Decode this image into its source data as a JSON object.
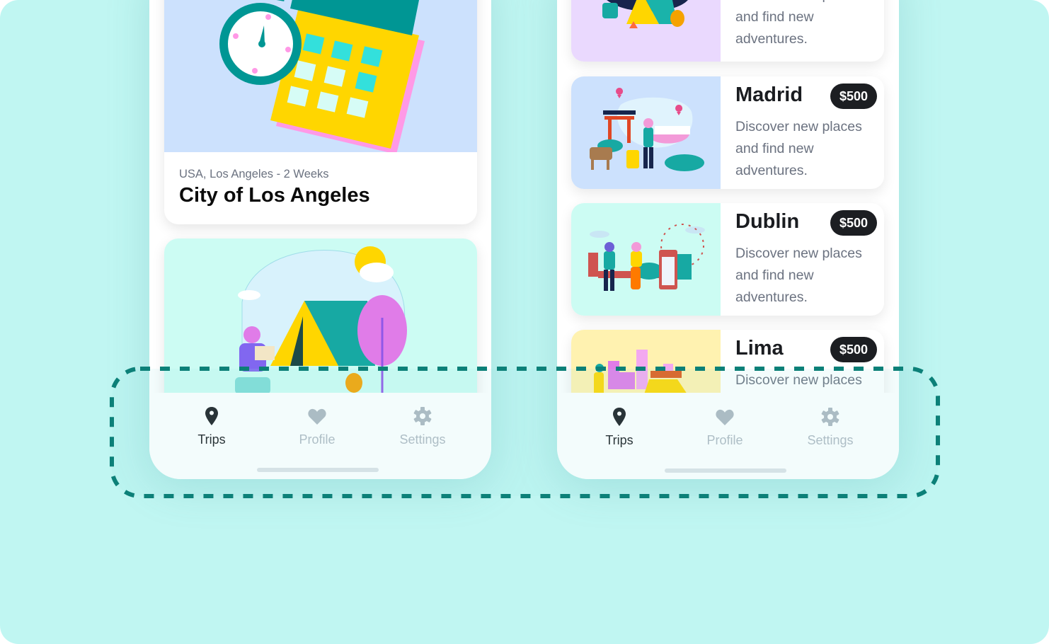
{
  "colors": {
    "background": "#c0f6f2",
    "accent_dash": "#0c8078",
    "price_badge": "#1c1e22",
    "tab_active": "#1a1c20",
    "tab_inactive": "#b1b9c2"
  },
  "left_phone": {
    "featured_card": {
      "meta": "USA, Los Angeles - 2 Weeks",
      "title": "City of Los Angeles",
      "illustration": "calendar-stopwatch-illustration"
    },
    "second_card": {
      "illustration": "camping-tent-illustration"
    },
    "tabbar": {
      "tabs": [
        {
          "label": "Trips",
          "icon": "map-pin-icon",
          "active": true
        },
        {
          "label": "Profile",
          "icon": "heart-icon",
          "active": false
        },
        {
          "label": "Settings",
          "icon": "gear-icon",
          "active": false
        }
      ]
    }
  },
  "right_phone": {
    "trips": [
      {
        "name": "",
        "price": "",
        "description": "Discover new places and find new adventures.",
        "illustration": "night-camping-illustration"
      },
      {
        "name": "Madrid",
        "price": "$500",
        "description": "Discover new places and find new adventures.",
        "illustration": "torii-travel-illustration"
      },
      {
        "name": "Dublin",
        "price": "$500",
        "description": "Discover new places and find new adventures.",
        "illustration": "london-phonebooth-illustration"
      },
      {
        "name": "Lima",
        "price": "$500",
        "description": "Discover new places",
        "illustration": "city-taxi-illustration"
      }
    ],
    "tabbar": {
      "tabs": [
        {
          "label": "Trips",
          "icon": "map-pin-icon",
          "active": true
        },
        {
          "label": "Profile",
          "icon": "heart-icon",
          "active": false
        },
        {
          "label": "Settings",
          "icon": "gear-icon",
          "active": false
        }
      ]
    }
  }
}
